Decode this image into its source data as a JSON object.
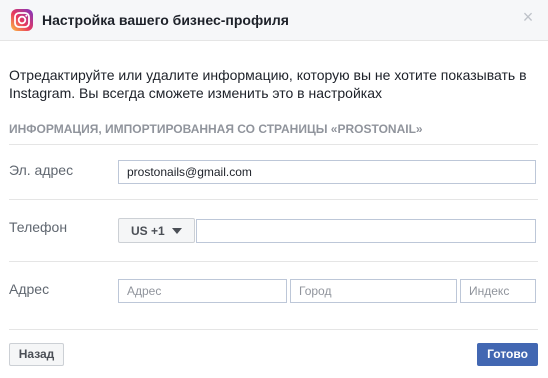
{
  "dialog": {
    "title": "Настройка вашего бизнес-профиля",
    "close_glyph": "×",
    "logo_icon": "instagram-icon"
  },
  "intro_text": "Отредактируйте или удалите информацию, которую вы не хотите показывать в Instagram. Вы всегда сможете изменить это в настройках",
  "section_title": "ИНФОРМАЦИЯ, ИМПОРТИРОВАННАЯ СО СТРАНИЦЫ «PROSTONAIL»",
  "fields": {
    "email": {
      "label": "Эл. адрес",
      "value": "prostonails@gmail.com"
    },
    "phone": {
      "label": "Телефон",
      "country_code": "US +1",
      "value": ""
    },
    "address": {
      "label": "Адрес",
      "street_placeholder": "Адрес",
      "city_placeholder": "Город",
      "zip_placeholder": "Индекс"
    }
  },
  "buttons": {
    "back": "Назад",
    "done": "Готово"
  },
  "colors": {
    "accent": "#4267b2",
    "header_bg": "#f6f7f9",
    "secondary_text": "#606770",
    "section_text": "#90949c"
  }
}
